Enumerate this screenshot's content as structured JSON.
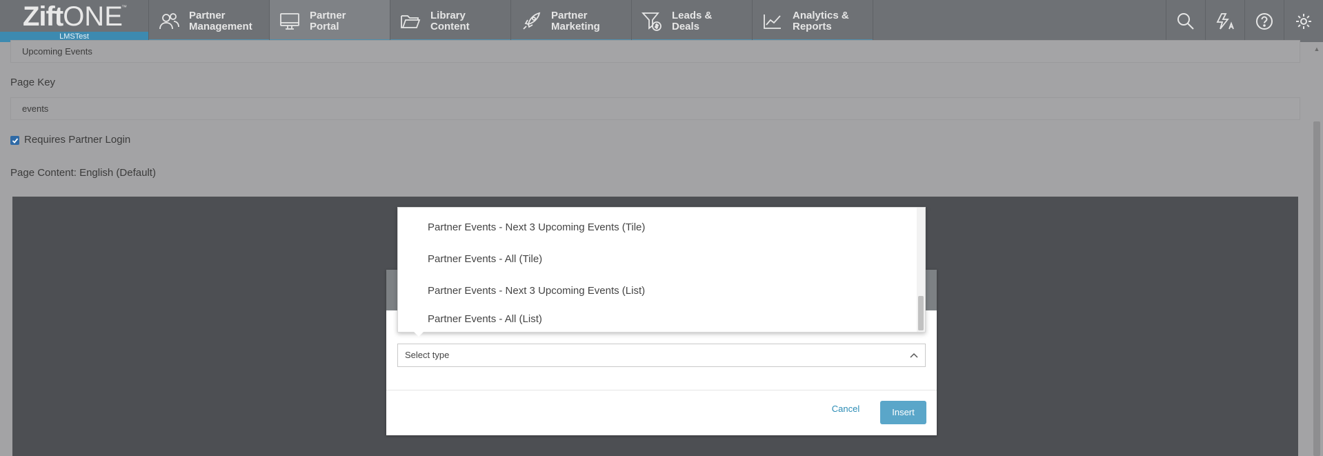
{
  "brand": {
    "logo_main": "Zift",
    "logo_one": "ONE",
    "logo_tm": "™",
    "tenant": "LMSTest"
  },
  "nav": {
    "items": [
      {
        "label": "Partner\nManagement",
        "icon": "people-icon",
        "active": false
      },
      {
        "label": "Partner\nPortal",
        "icon": "monitor-icon",
        "active": true
      },
      {
        "label": "Library\nContent",
        "icon": "folder-icon",
        "active": false
      },
      {
        "label": "Partner\nMarketing",
        "icon": "rocket-icon",
        "active": false
      },
      {
        "label": "Leads &\nDeals",
        "icon": "funnel-dollar-icon",
        "active": false
      },
      {
        "label": "Analytics &\nReports",
        "icon": "line-chart-icon",
        "active": false
      }
    ],
    "tools": [
      "search-icon",
      "translate-icon",
      "help-icon",
      "gear-icon"
    ]
  },
  "form": {
    "page_name_value": "Upcoming Events",
    "page_key_label": "Page Key",
    "page_key_value": "events",
    "requires_login_label": "Requires Partner Login",
    "requires_login_checked": true,
    "page_content_label": "Page Content: English (Default)"
  },
  "modal": {
    "select_placeholder": "Select type",
    "cancel_label": "Cancel",
    "insert_label": "Insert"
  },
  "dropdown": {
    "options": [
      "Partner Events - Next 3 Upcoming Events (Tile)",
      "Partner Events - All (Tile)",
      "Partner Events - Next 3 Upcoming Events (List)",
      "Partner Events - All (List)"
    ]
  },
  "colors": {
    "accent": "#4d8fae",
    "button": "#5aa6c9",
    "link": "#2b8cb5"
  }
}
